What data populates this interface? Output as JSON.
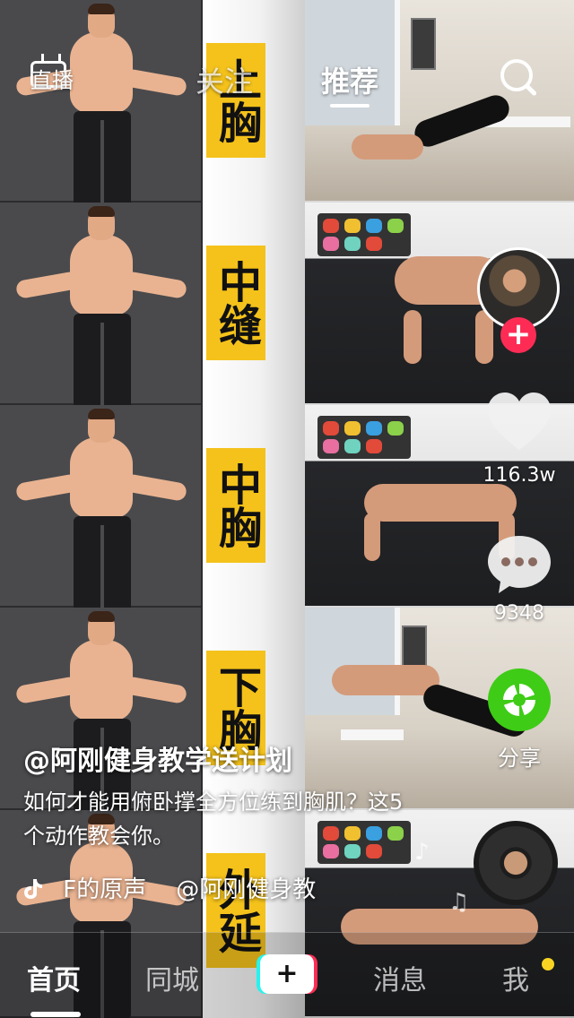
{
  "top_nav": {
    "live_label": "直播",
    "tabs": [
      {
        "label": "关注",
        "active": false
      },
      {
        "label": "推荐",
        "active": true
      }
    ],
    "search_icon": "search-icon"
  },
  "video": {
    "overlay_tags": [
      "上胸",
      "中缝",
      "中胸",
      "下胸",
      "外延"
    ]
  },
  "right_rail": {
    "like_count": "116.3w",
    "comment_count": "9348",
    "share_label": "分享",
    "follow_symbol": "+"
  },
  "caption": {
    "author": "@阿刚健身教学送计划",
    "description": "如何才能用俯卧撑全方位练到胸肌？这5个动作教会你。",
    "music": "F的原声    @阿刚健身教"
  },
  "bottom_nav": {
    "items": [
      "首页",
      "同城",
      "消息",
      "我"
    ],
    "create_symbol": "+"
  },
  "colors": {
    "accent": "#fe2c55",
    "cyan": "#25f4ee",
    "share_green": "#3ecc16",
    "tag_yellow": "#f4c21b",
    "notification_dot": "#f9d423"
  }
}
